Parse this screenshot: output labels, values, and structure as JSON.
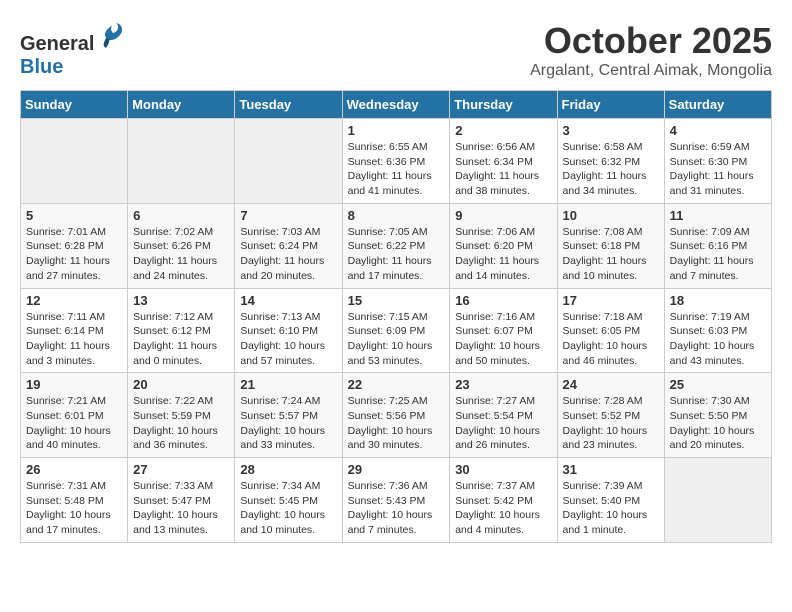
{
  "header": {
    "logo": {
      "general": "General",
      "blue": "Blue"
    },
    "title": "October 2025",
    "subtitle": "Argalant, Central Aimak, Mongolia"
  },
  "calendar": {
    "days_of_week": [
      "Sunday",
      "Monday",
      "Tuesday",
      "Wednesday",
      "Thursday",
      "Friday",
      "Saturday"
    ],
    "weeks": [
      [
        {
          "day": "",
          "info": ""
        },
        {
          "day": "",
          "info": ""
        },
        {
          "day": "",
          "info": ""
        },
        {
          "day": "1",
          "info": "Sunrise: 6:55 AM\nSunset: 6:36 PM\nDaylight: 11 hours\nand 41 minutes."
        },
        {
          "day": "2",
          "info": "Sunrise: 6:56 AM\nSunset: 6:34 PM\nDaylight: 11 hours\nand 38 minutes."
        },
        {
          "day": "3",
          "info": "Sunrise: 6:58 AM\nSunset: 6:32 PM\nDaylight: 11 hours\nand 34 minutes."
        },
        {
          "day": "4",
          "info": "Sunrise: 6:59 AM\nSunset: 6:30 PM\nDaylight: 11 hours\nand 31 minutes."
        }
      ],
      [
        {
          "day": "5",
          "info": "Sunrise: 7:01 AM\nSunset: 6:28 PM\nDaylight: 11 hours\nand 27 minutes."
        },
        {
          "day": "6",
          "info": "Sunrise: 7:02 AM\nSunset: 6:26 PM\nDaylight: 11 hours\nand 24 minutes."
        },
        {
          "day": "7",
          "info": "Sunrise: 7:03 AM\nSunset: 6:24 PM\nDaylight: 11 hours\nand 20 minutes."
        },
        {
          "day": "8",
          "info": "Sunrise: 7:05 AM\nSunset: 6:22 PM\nDaylight: 11 hours\nand 17 minutes."
        },
        {
          "day": "9",
          "info": "Sunrise: 7:06 AM\nSunset: 6:20 PM\nDaylight: 11 hours\nand 14 minutes."
        },
        {
          "day": "10",
          "info": "Sunrise: 7:08 AM\nSunset: 6:18 PM\nDaylight: 11 hours\nand 10 minutes."
        },
        {
          "day": "11",
          "info": "Sunrise: 7:09 AM\nSunset: 6:16 PM\nDaylight: 11 hours\nand 7 minutes."
        }
      ],
      [
        {
          "day": "12",
          "info": "Sunrise: 7:11 AM\nSunset: 6:14 PM\nDaylight: 11 hours\nand 3 minutes."
        },
        {
          "day": "13",
          "info": "Sunrise: 7:12 AM\nSunset: 6:12 PM\nDaylight: 11 hours\nand 0 minutes."
        },
        {
          "day": "14",
          "info": "Sunrise: 7:13 AM\nSunset: 6:10 PM\nDaylight: 10 hours\nand 57 minutes."
        },
        {
          "day": "15",
          "info": "Sunrise: 7:15 AM\nSunset: 6:09 PM\nDaylight: 10 hours\nand 53 minutes."
        },
        {
          "day": "16",
          "info": "Sunrise: 7:16 AM\nSunset: 6:07 PM\nDaylight: 10 hours\nand 50 minutes."
        },
        {
          "day": "17",
          "info": "Sunrise: 7:18 AM\nSunset: 6:05 PM\nDaylight: 10 hours\nand 46 minutes."
        },
        {
          "day": "18",
          "info": "Sunrise: 7:19 AM\nSunset: 6:03 PM\nDaylight: 10 hours\nand 43 minutes."
        }
      ],
      [
        {
          "day": "19",
          "info": "Sunrise: 7:21 AM\nSunset: 6:01 PM\nDaylight: 10 hours\nand 40 minutes."
        },
        {
          "day": "20",
          "info": "Sunrise: 7:22 AM\nSunset: 5:59 PM\nDaylight: 10 hours\nand 36 minutes."
        },
        {
          "day": "21",
          "info": "Sunrise: 7:24 AM\nSunset: 5:57 PM\nDaylight: 10 hours\nand 33 minutes."
        },
        {
          "day": "22",
          "info": "Sunrise: 7:25 AM\nSunset: 5:56 PM\nDaylight: 10 hours\nand 30 minutes."
        },
        {
          "day": "23",
          "info": "Sunrise: 7:27 AM\nSunset: 5:54 PM\nDaylight: 10 hours\nand 26 minutes."
        },
        {
          "day": "24",
          "info": "Sunrise: 7:28 AM\nSunset: 5:52 PM\nDaylight: 10 hours\nand 23 minutes."
        },
        {
          "day": "25",
          "info": "Sunrise: 7:30 AM\nSunset: 5:50 PM\nDaylight: 10 hours\nand 20 minutes."
        }
      ],
      [
        {
          "day": "26",
          "info": "Sunrise: 7:31 AM\nSunset: 5:48 PM\nDaylight: 10 hours\nand 17 minutes."
        },
        {
          "day": "27",
          "info": "Sunrise: 7:33 AM\nSunset: 5:47 PM\nDaylight: 10 hours\nand 13 minutes."
        },
        {
          "day": "28",
          "info": "Sunrise: 7:34 AM\nSunset: 5:45 PM\nDaylight: 10 hours\nand 10 minutes."
        },
        {
          "day": "29",
          "info": "Sunrise: 7:36 AM\nSunset: 5:43 PM\nDaylight: 10 hours\nand 7 minutes."
        },
        {
          "day": "30",
          "info": "Sunrise: 7:37 AM\nSunset: 5:42 PM\nDaylight: 10 hours\nand 4 minutes."
        },
        {
          "day": "31",
          "info": "Sunrise: 7:39 AM\nSunset: 5:40 PM\nDaylight: 10 hours\nand 1 minute."
        },
        {
          "day": "",
          "info": ""
        }
      ]
    ]
  }
}
